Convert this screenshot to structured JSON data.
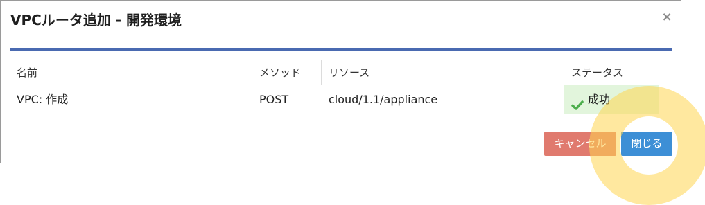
{
  "dialog": {
    "title": "VPCルータ追加 - 開発環境",
    "close_glyph": "×"
  },
  "table": {
    "headers": [
      "名前",
      "メソッド",
      "リソース",
      "ステータス"
    ],
    "rows": [
      {
        "name": "VPC: 作成",
        "method": "POST",
        "resource": "cloud/1.1/appliance",
        "status": "成功",
        "status_icon": "check-icon",
        "status_color": "#4cae4c"
      }
    ]
  },
  "footer": {
    "cancel_label": "キャンセル",
    "close_label": "閉じる"
  },
  "colors": {
    "title_rule": "#4a6ab1",
    "cancel_button": "#e07a6e",
    "close_button": "#3d8fd6",
    "status_background": "#e2f5dc",
    "click_highlight": "#ffd650"
  }
}
